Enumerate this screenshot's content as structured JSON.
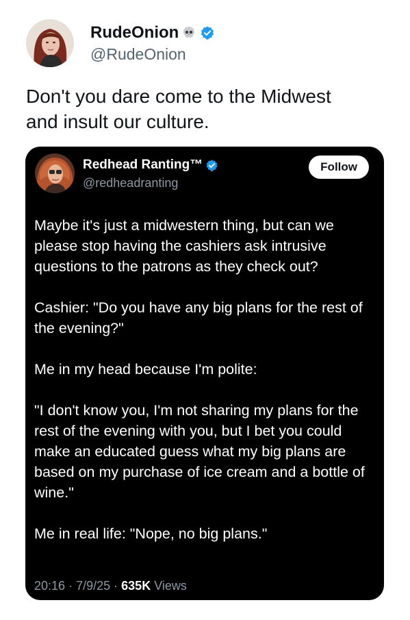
{
  "outer_tweet": {
    "display_name": "RudeOnion",
    "handle": "@RudeOnion",
    "name_emoji": "skull-icon",
    "verified_color": "#1d9bf0",
    "text_line1": "Don't you dare come to the Midwest",
    "text_line2": "and insult our culture."
  },
  "quoted_tweet": {
    "display_name": "Redhead Ranting™",
    "handle": "@redheadranting",
    "follow_label": "Follow",
    "paragraphs": [
      "Maybe it's just a midwestern thing, but can we please stop having the cashiers ask intrusive questions to the patrons as they check out?",
      "Cashier: \"Do you have any big plans for the rest of the evening?\"",
      "Me in my head because I'm polite:",
      "\"I don't know you, I'm not sharing my plans for the rest of the evening with you, but I bet you could make an educated guess what my big plans are based on my purchase of ice cream and a bottle of wine.\"",
      "Me in real life: \"Nope, no big plans.\""
    ],
    "time": "20:16",
    "date": "7/9/25",
    "separator": "·",
    "views_count": "635K",
    "views_label": "Views"
  }
}
